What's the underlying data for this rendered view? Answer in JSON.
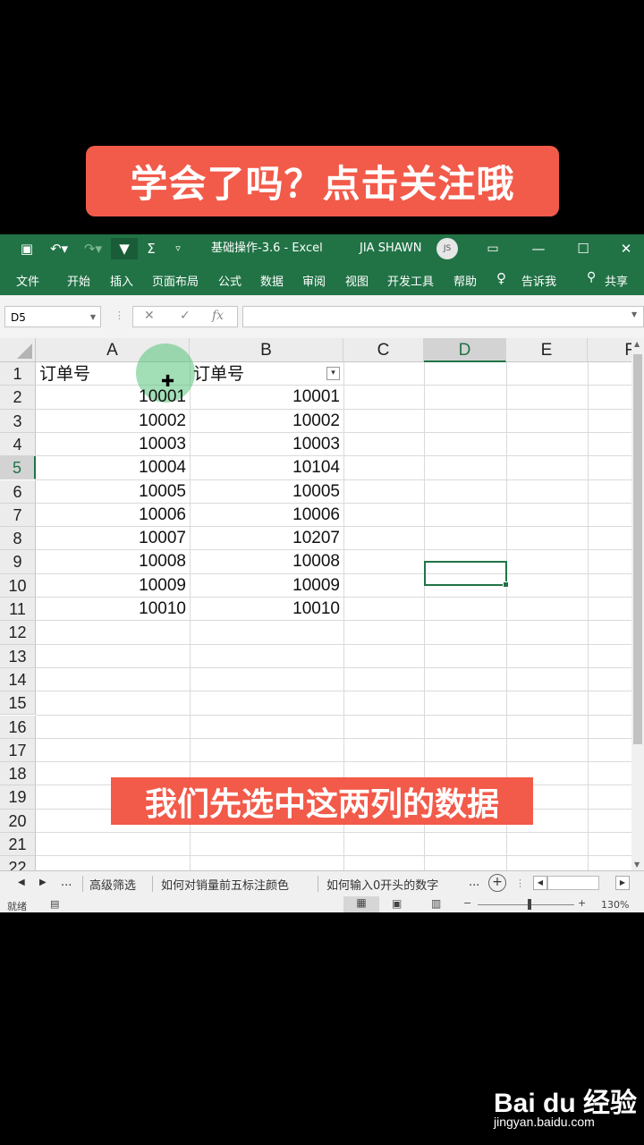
{
  "banner": {
    "text": "学会了吗？点击关注哦"
  },
  "titlebar": {
    "save_icon": "save-icon",
    "undo_icon": "undo-icon",
    "filter_icon": "filter-icon",
    "sum_icon": "sum-icon",
    "title": "基础操作-3.6 - Excel",
    "user": "JIA SHAWN",
    "avatar": "JS"
  },
  "ribbon": {
    "tabs": [
      "文件",
      "开始",
      "插入",
      "页面布局",
      "公式",
      "数据",
      "审阅",
      "视图",
      "开发工具",
      "帮助",
      "告诉我",
      "共享"
    ]
  },
  "formula_bar": {
    "name_box": "D5",
    "cancel": "✕",
    "enter": "✓",
    "fx": "fx",
    "value": ""
  },
  "sheet": {
    "columns": [
      "A",
      "B",
      "C",
      "D",
      "E",
      "F"
    ],
    "selected_column": "D",
    "rows": [
      "1",
      "2",
      "3",
      "4",
      "5",
      "6",
      "7",
      "8",
      "9",
      "10",
      "11",
      "12",
      "13",
      "14",
      "15",
      "16",
      "17",
      "18",
      "19",
      "20",
      "21",
      "22"
    ],
    "selected_row": "5",
    "header_a": "订单号",
    "header_b": "订单号",
    "col_a": [
      "10001",
      "10002",
      "10003",
      "10004",
      "10005",
      "10006",
      "10007",
      "10008",
      "10009",
      "10010"
    ],
    "col_b": [
      "10001",
      "10002",
      "10003",
      "10104",
      "10005",
      "10006",
      "10207",
      "10008",
      "10009",
      "10010"
    ],
    "active_cell": "D5"
  },
  "sheet_tabs": {
    "ellipsis": "...",
    "tabs": [
      "高级筛选",
      "如何对销量前五标注颜色",
      "如何输入0开头的数字"
    ],
    "more": "..."
  },
  "status": {
    "ready": "就绪",
    "zoom": "130%"
  },
  "caption": {
    "text": "我们先选中这两列的数据"
  },
  "watermark": {
    "brand": "Bai du 经验",
    "url": "jingyan.baidu.com"
  }
}
